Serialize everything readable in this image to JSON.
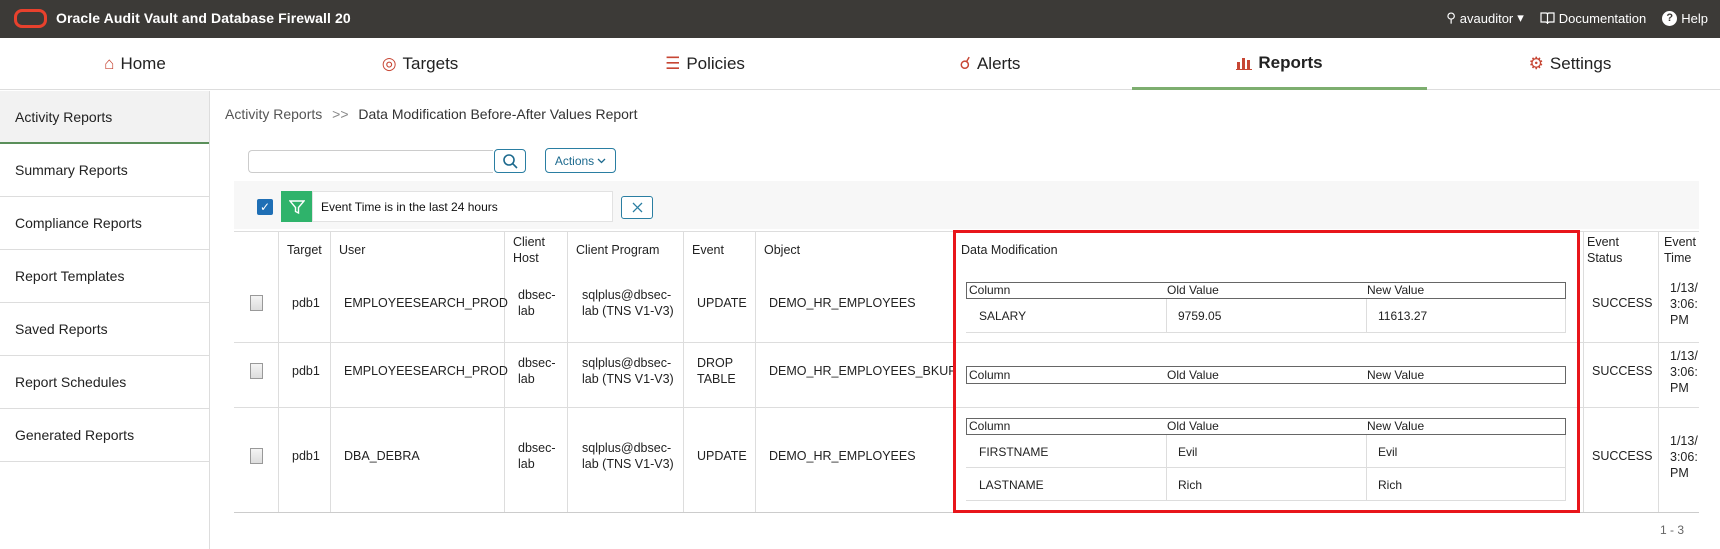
{
  "header": {
    "app_title": "Oracle Audit Vault and Database Firewall 20",
    "user": "avauditor",
    "documentation": "Documentation",
    "help": "Help"
  },
  "nav": {
    "tabs": [
      {
        "label": "Home",
        "icon": "home-icon"
      },
      {
        "label": "Targets",
        "icon": "target-icon"
      },
      {
        "label": "Policies",
        "icon": "policies-icon"
      },
      {
        "label": "Alerts",
        "icon": "bell-icon"
      },
      {
        "label": "Reports",
        "icon": "chart-icon",
        "active": true
      },
      {
        "label": "Settings",
        "icon": "gear-icon"
      }
    ]
  },
  "sidebar": {
    "items": [
      {
        "label": "Activity Reports",
        "active": true
      },
      {
        "label": "Summary Reports"
      },
      {
        "label": "Compliance Reports"
      },
      {
        "label": "Report Templates"
      },
      {
        "label": "Saved Reports"
      },
      {
        "label": "Report Schedules"
      },
      {
        "label": "Generated Reports"
      }
    ]
  },
  "breadcrumb": {
    "parent": "Activity Reports",
    "separator": ">>",
    "current": "Data Modification Before-After Values Report"
  },
  "toolbar": {
    "search_placeholder": "",
    "actions_label": "Actions"
  },
  "filter": {
    "label": "Event Time is in the last 24 hours"
  },
  "table": {
    "headers": {
      "target": "Target",
      "user": "User",
      "client_host": "Client Host",
      "client_program": "Client Program",
      "event": "Event",
      "object": "Object",
      "data_modification": "Data Modification",
      "event_status": "Event Status",
      "event_time": "Event Time"
    },
    "dm_headers": {
      "column": "Column",
      "old": "Old Value",
      "new": "New Value"
    },
    "rows": [
      {
        "target": "pdb1",
        "user": "EMPLOYEESEARCH_PROD",
        "client_host": "dbsec-lab",
        "client_program": "sqlplus@dbsec-lab (TNS V1-V3)",
        "event": "UPDATE",
        "object": "DEMO_HR_EMPLOYEES",
        "changes": [
          {
            "column": "SALARY",
            "old": "9759.05",
            "new": "11613.27"
          }
        ],
        "status": "SUCCESS",
        "time": "1/13/ 3:06: PM"
      },
      {
        "target": "pdb1",
        "user": "EMPLOYEESEARCH_PROD",
        "client_host": "dbsec-lab",
        "client_program": "sqlplus@dbsec-lab (TNS V1-V3)",
        "event": "DROP TABLE",
        "object": "DEMO_HR_EMPLOYEES_BKUP",
        "changes": [],
        "status": "SUCCESS",
        "time": "1/13/ 3:06: PM"
      },
      {
        "target": "pdb1",
        "user": "DBA_DEBRA",
        "client_host": "dbsec-lab",
        "client_program": "sqlplus@dbsec-lab (TNS V1-V3)",
        "event": "UPDATE",
        "object": "DEMO_HR_EMPLOYEES",
        "changes": [
          {
            "column": "FIRSTNAME",
            "old": "Evil",
            "new": "Evil"
          },
          {
            "column": "LASTNAME",
            "old": "Rich",
            "new": "Rich"
          }
        ],
        "status": "SUCCESS",
        "time": "1/13/ 3:06: PM"
      }
    ]
  },
  "pagination": "1 - 3",
  "colors": {
    "topbar": "#3c3a37",
    "oracle_red": "#c74634",
    "active_tab_underline": "#7dae6f",
    "filter_green": "#2fb36b",
    "highlight_red": "#e8151b",
    "button_blue": "#2a7ea2"
  }
}
